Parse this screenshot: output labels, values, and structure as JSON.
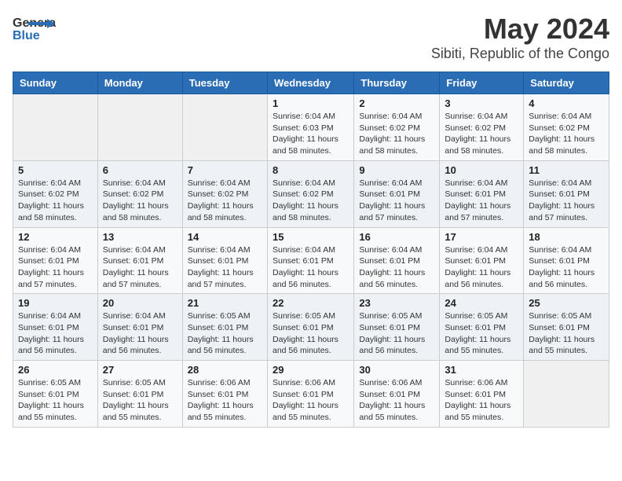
{
  "app": {
    "logo_line1": "General",
    "logo_line2": "Blue"
  },
  "title": "May 2024",
  "subtitle": "Sibiti, Republic of the Congo",
  "calendar": {
    "headers": [
      "Sunday",
      "Monday",
      "Tuesday",
      "Wednesday",
      "Thursday",
      "Friday",
      "Saturday"
    ],
    "weeks": [
      [
        {
          "day": "",
          "info": ""
        },
        {
          "day": "",
          "info": ""
        },
        {
          "day": "",
          "info": ""
        },
        {
          "day": "1",
          "info": "Sunrise: 6:04 AM\nSunset: 6:03 PM\nDaylight: 11 hours\nand 58 minutes."
        },
        {
          "day": "2",
          "info": "Sunrise: 6:04 AM\nSunset: 6:02 PM\nDaylight: 11 hours\nand 58 minutes."
        },
        {
          "day": "3",
          "info": "Sunrise: 6:04 AM\nSunset: 6:02 PM\nDaylight: 11 hours\nand 58 minutes."
        },
        {
          "day": "4",
          "info": "Sunrise: 6:04 AM\nSunset: 6:02 PM\nDaylight: 11 hours\nand 58 minutes."
        }
      ],
      [
        {
          "day": "5",
          "info": "Sunrise: 6:04 AM\nSunset: 6:02 PM\nDaylight: 11 hours\nand 58 minutes."
        },
        {
          "day": "6",
          "info": "Sunrise: 6:04 AM\nSunset: 6:02 PM\nDaylight: 11 hours\nand 58 minutes."
        },
        {
          "day": "7",
          "info": "Sunrise: 6:04 AM\nSunset: 6:02 PM\nDaylight: 11 hours\nand 58 minutes."
        },
        {
          "day": "8",
          "info": "Sunrise: 6:04 AM\nSunset: 6:02 PM\nDaylight: 11 hours\nand 58 minutes."
        },
        {
          "day": "9",
          "info": "Sunrise: 6:04 AM\nSunset: 6:01 PM\nDaylight: 11 hours\nand 57 minutes."
        },
        {
          "day": "10",
          "info": "Sunrise: 6:04 AM\nSunset: 6:01 PM\nDaylight: 11 hours\nand 57 minutes."
        },
        {
          "day": "11",
          "info": "Sunrise: 6:04 AM\nSunset: 6:01 PM\nDaylight: 11 hours\nand 57 minutes."
        }
      ],
      [
        {
          "day": "12",
          "info": "Sunrise: 6:04 AM\nSunset: 6:01 PM\nDaylight: 11 hours\nand 57 minutes."
        },
        {
          "day": "13",
          "info": "Sunrise: 6:04 AM\nSunset: 6:01 PM\nDaylight: 11 hours\nand 57 minutes."
        },
        {
          "day": "14",
          "info": "Sunrise: 6:04 AM\nSunset: 6:01 PM\nDaylight: 11 hours\nand 57 minutes."
        },
        {
          "day": "15",
          "info": "Sunrise: 6:04 AM\nSunset: 6:01 PM\nDaylight: 11 hours\nand 56 minutes."
        },
        {
          "day": "16",
          "info": "Sunrise: 6:04 AM\nSunset: 6:01 PM\nDaylight: 11 hours\nand 56 minutes."
        },
        {
          "day": "17",
          "info": "Sunrise: 6:04 AM\nSunset: 6:01 PM\nDaylight: 11 hours\nand 56 minutes."
        },
        {
          "day": "18",
          "info": "Sunrise: 6:04 AM\nSunset: 6:01 PM\nDaylight: 11 hours\nand 56 minutes."
        }
      ],
      [
        {
          "day": "19",
          "info": "Sunrise: 6:04 AM\nSunset: 6:01 PM\nDaylight: 11 hours\nand 56 minutes."
        },
        {
          "day": "20",
          "info": "Sunrise: 6:04 AM\nSunset: 6:01 PM\nDaylight: 11 hours\nand 56 minutes."
        },
        {
          "day": "21",
          "info": "Sunrise: 6:05 AM\nSunset: 6:01 PM\nDaylight: 11 hours\nand 56 minutes."
        },
        {
          "day": "22",
          "info": "Sunrise: 6:05 AM\nSunset: 6:01 PM\nDaylight: 11 hours\nand 56 minutes."
        },
        {
          "day": "23",
          "info": "Sunrise: 6:05 AM\nSunset: 6:01 PM\nDaylight: 11 hours\nand 56 minutes."
        },
        {
          "day": "24",
          "info": "Sunrise: 6:05 AM\nSunset: 6:01 PM\nDaylight: 11 hours\nand 55 minutes."
        },
        {
          "day": "25",
          "info": "Sunrise: 6:05 AM\nSunset: 6:01 PM\nDaylight: 11 hours\nand 55 minutes."
        }
      ],
      [
        {
          "day": "26",
          "info": "Sunrise: 6:05 AM\nSunset: 6:01 PM\nDaylight: 11 hours\nand 55 minutes."
        },
        {
          "day": "27",
          "info": "Sunrise: 6:05 AM\nSunset: 6:01 PM\nDaylight: 11 hours\nand 55 minutes."
        },
        {
          "day": "28",
          "info": "Sunrise: 6:06 AM\nSunset: 6:01 PM\nDaylight: 11 hours\nand 55 minutes."
        },
        {
          "day": "29",
          "info": "Sunrise: 6:06 AM\nSunset: 6:01 PM\nDaylight: 11 hours\nand 55 minutes."
        },
        {
          "day": "30",
          "info": "Sunrise: 6:06 AM\nSunset: 6:01 PM\nDaylight: 11 hours\nand 55 minutes."
        },
        {
          "day": "31",
          "info": "Sunrise: 6:06 AM\nSunset: 6:01 PM\nDaylight: 11 hours\nand 55 minutes."
        },
        {
          "day": "",
          "info": ""
        }
      ]
    ]
  }
}
